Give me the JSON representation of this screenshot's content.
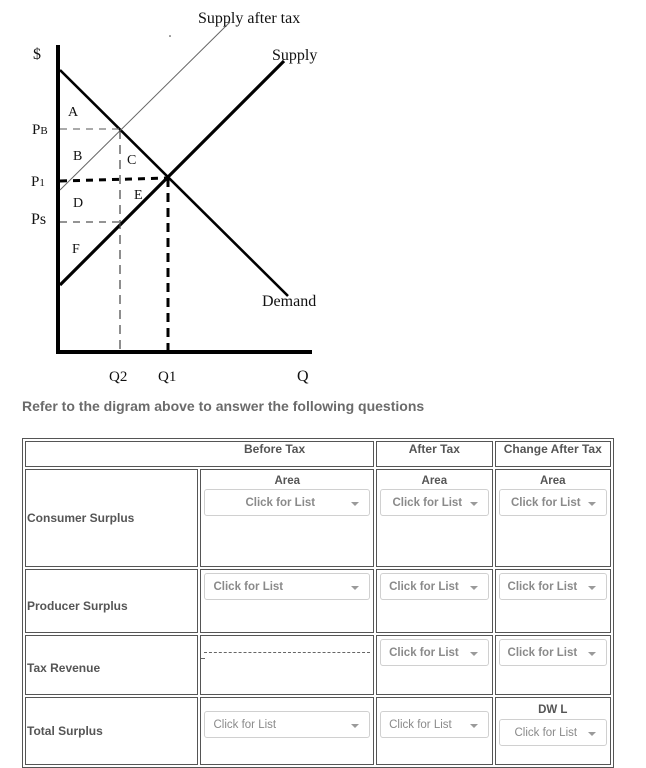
{
  "diagram": {
    "labels": {
      "y_axis": "$",
      "x_axis": "Q",
      "supply_after_tax": "Supply after tax",
      "supply": "Supply",
      "demand": "Demand",
      "pb": "PB",
      "p1": "P1",
      "ps": "Ps",
      "q2": "Q2",
      "q1": "Q1",
      "areas": [
        "A",
        "B",
        "C",
        "D",
        "E",
        "F"
      ]
    }
  },
  "instruction": "Refer to the digram above to answer the following questions",
  "table": {
    "headers": {
      "before_tax": "Before Tax",
      "after_tax": "After Tax",
      "change_after_tax": "Change After Tax"
    },
    "rows": [
      {
        "label": "Consumer  Surplus",
        "before": {
          "sublabel": "Area",
          "dropdown": "Click for List"
        },
        "after": {
          "sublabel": "Area",
          "dropdown": "Click for List"
        },
        "change": {
          "sublabel": "Area",
          "dropdown": "Click for List"
        }
      },
      {
        "label": "Producer  Surplus",
        "before": {
          "dropdown": "Click for List"
        },
        "after": {
          "dropdown": "Click for List"
        },
        "change": {
          "dropdown": "Click for List"
        }
      },
      {
        "label": "Tax Revenue",
        "before": {
          "placeholder_line": "----------------------------------------",
          "tick": "-"
        },
        "after": {
          "dropdown": "Click for List"
        },
        "change": {
          "dropdown": "Click for List"
        }
      },
      {
        "label": "Total Surplus",
        "before": {
          "dropdown": "Click for List"
        },
        "after": {
          "dropdown": "Click for List"
        },
        "change": {
          "sublabel": "DW L",
          "dropdown": "Click for List"
        }
      }
    ]
  }
}
